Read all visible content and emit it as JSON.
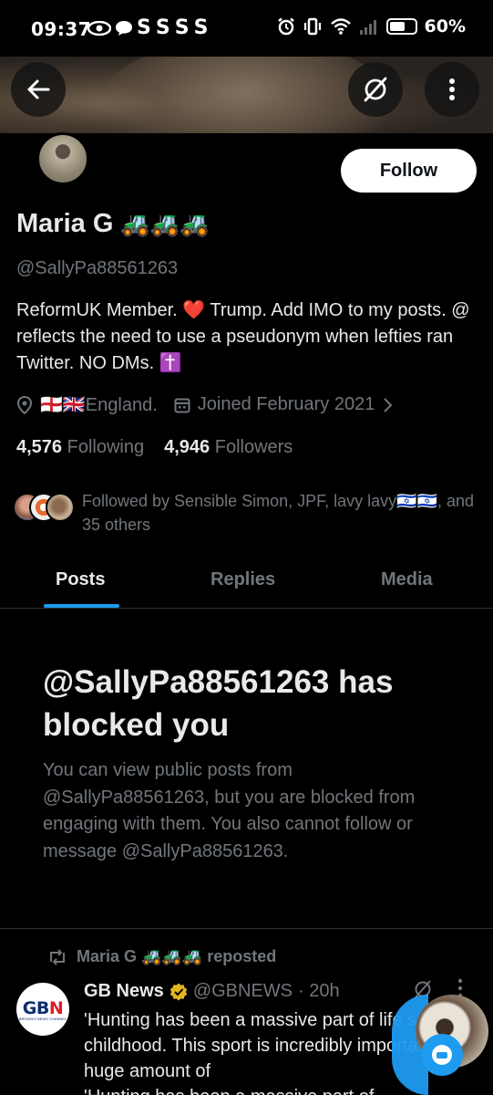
{
  "status_bar": {
    "time": "09:37",
    "left_icons": "SSSS",
    "battery": "60%"
  },
  "header": {
    "back_icon": "arrow-left-icon",
    "grok_icon": "grok-icon",
    "more_icon": "more-vertical-icon"
  },
  "profile": {
    "name": "Maria G",
    "name_emoji": "🚜🚜🚜",
    "handle": "@SallyPa88561263",
    "follow_label": "Follow",
    "bio": "ReformUK Member. ❤️ Trump. Add IMO to my posts. @ reflects the need to use a pseudonym when lefties ran Twitter. NO DMs. ✝️",
    "location": "🏴󠁧󠁢󠁥󠁮󠁧󠁿🇬🇧England.",
    "joined": "Joined February 2021",
    "following_count": "4,576",
    "following_label": "Following",
    "followers_count": "4,946",
    "followers_label": "Followers",
    "followed_by": "Followed by Sensible Simon, JPF, lavy lavy🇮🇱🇮🇱, and 35 others"
  },
  "tabs": [
    {
      "label": "Posts"
    },
    {
      "label": "Replies"
    },
    {
      "label": "Media"
    }
  ],
  "blocked": {
    "title": "@SallyPa88561263 has blocked you",
    "description": "You can view public posts from @SallyPa88561263, but you are blocked from engaging with them. You also cannot follow or message @SallyPa88561263."
  },
  "post": {
    "repost_by": "Maria G 🚜🚜🚜 reposted",
    "author_name": "GB News",
    "author_handle": "@GBNEWS",
    "time": "· 20h",
    "avatar_text_main": "GB",
    "avatar_text_n": "N",
    "avatar_sub": "BRITAIN'S NEWS CHANNEL",
    "text": "'Hunting has been a massive part of life since childhood. This sport is incredibly important to a huge amount of",
    "cut_text": "'Hunting has been a massive part of"
  },
  "colors": {
    "background": "#000000",
    "text_primary": "#e7e9ea",
    "text_secondary": "#71767b",
    "accent": "#1d9bf0",
    "divider": "#2f3336"
  }
}
